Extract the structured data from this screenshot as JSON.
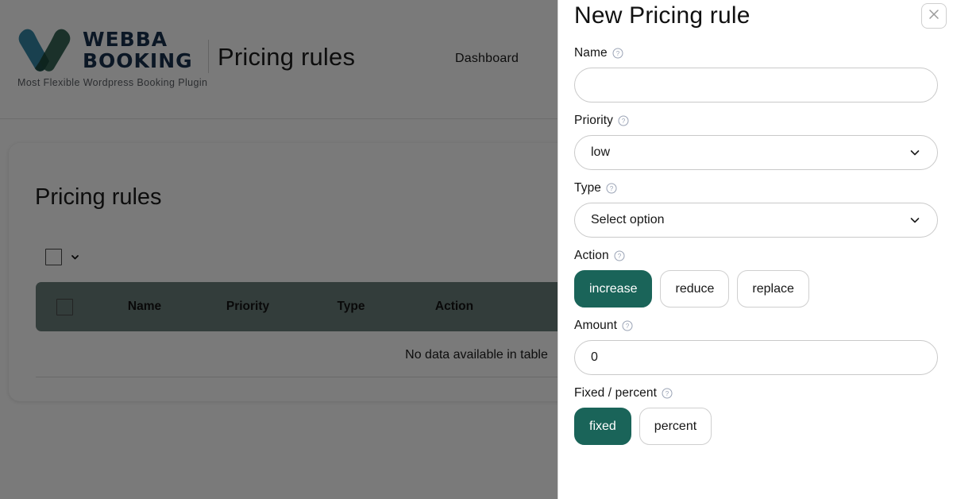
{
  "brand": {
    "name_line1": "WEBBA",
    "name_line2": "BOOKING",
    "tagline": "Most Flexible Wordpress Booking Plugin",
    "logo_icon": "webba-w-logo-icon",
    "color_blue": "#2a7fa0",
    "color_green": "#2e5f50",
    "color_text": "#17304f"
  },
  "header": {
    "page_title": "Pricing rules",
    "nav": {
      "dashboard_label": "Dashboard"
    }
  },
  "card": {
    "title": "Pricing rules",
    "bulk": {
      "checkbox_icon": "checkbox-icon",
      "caret_icon": "chevron-down-icon"
    },
    "table": {
      "header_bg": "#6c7f7c",
      "select_all_icon": "checkbox-icon",
      "columns": [
        "Name",
        "Priority",
        "Type",
        "Action"
      ],
      "empty_message": "No data available in table",
      "rows": []
    }
  },
  "panel": {
    "title": "New Pricing rule",
    "close_icon": "close-icon",
    "help_icon": "help-circle-icon",
    "accent_color": "#1a6459",
    "fields": {
      "name": {
        "label": "Name",
        "value": "",
        "placeholder": ""
      },
      "priority": {
        "label": "Priority",
        "value": "low",
        "caret_icon": "chevron-down-icon"
      },
      "type": {
        "label": "Type",
        "value": "Select option",
        "caret_icon": "chevron-down-icon"
      },
      "action": {
        "label": "Action",
        "options": [
          "increase",
          "reduce",
          "replace"
        ],
        "selected": "increase"
      },
      "amount": {
        "label": "Amount",
        "value": "0"
      },
      "fixed_percent": {
        "label": "Fixed / percent",
        "options": [
          "fixed",
          "percent"
        ],
        "selected": "fixed"
      }
    }
  }
}
